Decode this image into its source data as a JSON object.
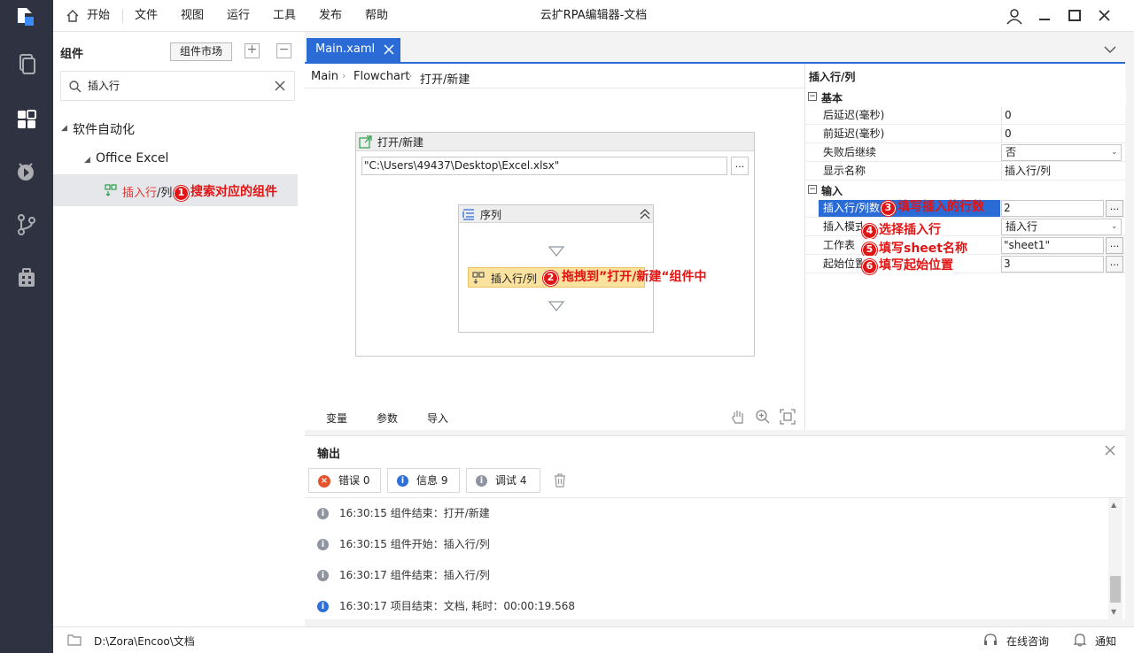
{
  "app": {
    "title": "云扩RPA编辑器-文档"
  },
  "menu": {
    "items": [
      "开始",
      "文件",
      "视图",
      "运行",
      "工具",
      "发布",
      "帮助"
    ]
  },
  "sidebar": {
    "icons": [
      "pages-icon",
      "components-icon",
      "debug-icon",
      "branch-icon",
      "toolbox-icon"
    ]
  },
  "components": {
    "header": "组件",
    "market_button": "组件市场",
    "search_value": "插入行",
    "tree": {
      "root": "软件自动化",
      "child": "Office Excel",
      "leaf_highlight": "插入行",
      "leaf_rest": "/列"
    }
  },
  "editor": {
    "tab": "Main.xaml",
    "breadcrumb": [
      "Main",
      "Flowchart",
      "打开/新建"
    ],
    "open_activity": {
      "title": "打开/新建",
      "path": "\"C:\\Users\\49437\\Desktop\\Excel.xlsx\"",
      "browse": "..."
    },
    "sequence": {
      "title": "序列",
      "activity": "插入行/列"
    },
    "bottom_tabs": [
      "变量",
      "参数",
      "导入"
    ]
  },
  "properties": {
    "title": "插入行/列",
    "sections": {
      "basic": "基本",
      "input": "输入"
    },
    "basic_rows": [
      {
        "label": "后延迟(毫秒)",
        "value": "0"
      },
      {
        "label": "前延迟(毫秒)",
        "value": "0"
      },
      {
        "label": "失败后继续",
        "value": "否"
      },
      {
        "label": "显示名称",
        "value": "插入行/列"
      }
    ],
    "input_rows": [
      {
        "label": "插入行/列数",
        "value": "2"
      },
      {
        "label": "插入模式",
        "value": "插入行"
      },
      {
        "label": "工作表",
        "value": "\"sheet1\""
      },
      {
        "label": "起始位置",
        "value": "3"
      }
    ],
    "button_label": "..."
  },
  "annotations": {
    "a1": {
      "num": "1",
      "text": "搜索对应的组件"
    },
    "a2": {
      "num": "2",
      "text": "拖拽到”打开/新建“组件中"
    },
    "a3": {
      "num": "3",
      "text": "填写插入的行数"
    },
    "a4": {
      "num": "4",
      "text": "选择插入行"
    },
    "a5": {
      "num": "5",
      "text": "填写sheet名称"
    },
    "a6": {
      "num": "6",
      "text": "填写起始位置"
    }
  },
  "output": {
    "title": "输出",
    "filters": [
      {
        "label": "错误",
        "count": "0"
      },
      {
        "label": "信息",
        "count": "9"
      },
      {
        "label": "调试",
        "count": "4"
      }
    ],
    "logs": [
      {
        "time": "16:30:15",
        "text": "组件结束：打开/新建"
      },
      {
        "time": "16:30:15",
        "text": "组件开始：插入行/列"
      },
      {
        "time": "16:30:17",
        "text": "组件结束：插入行/列"
      },
      {
        "time": "16:30:17",
        "text": "项目结束：文档, 耗时：00:00:19.568"
      }
    ]
  },
  "status": {
    "path": "D:\\Zora\\Encoo\\文档",
    "online": "在线咨询",
    "notify": "通知"
  },
  "colors": {
    "accent": "#2b6bd6",
    "sidebar": "#2f3241",
    "annotation": "#e01515"
  }
}
